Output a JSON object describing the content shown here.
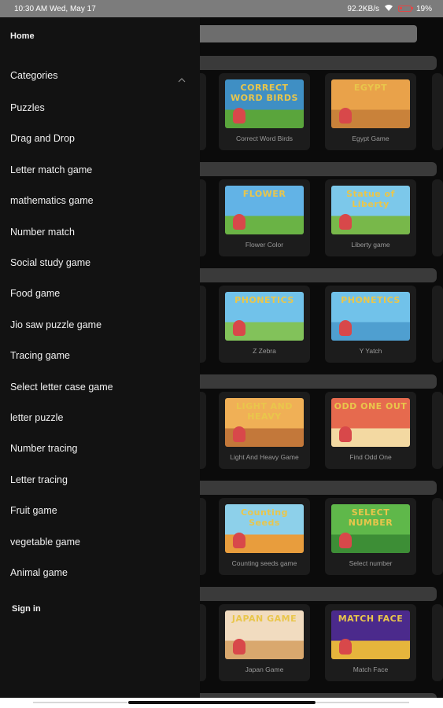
{
  "status_bar": {
    "time": "10:30 AM Wed, May 17",
    "network_speed": "92.2KB/s",
    "battery": "19%"
  },
  "drawer": {
    "home": "Home",
    "categories": "Categories",
    "items": [
      "Puzzles",
      "Drag and Drop",
      "Letter match game",
      "mathematics game",
      "Number match",
      "Social study game",
      "Food game",
      "Jio saw puzzle game",
      "Tracing game",
      "Select letter case game",
      "letter puzzle",
      "Number tracing",
      "Letter tracing",
      "Fruit game",
      "vegetable game",
      "Animal game"
    ],
    "sign_in": "Sign in"
  },
  "games": [
    [
      {
        "name": "Correct Word Birds",
        "thumb_title": "CORRECT WORD BIRDS",
        "bg": "#3f8fc4",
        "ground": "#5aa53c"
      },
      {
        "name": "Egypt Game",
        "thumb_title": "EGYPT",
        "bg": "#e9a24a",
        "ground": "#c9823a"
      }
    ],
    [
      {
        "name": "Flower Color",
        "thumb_title": "FLOWER",
        "bg": "#62b3e6",
        "ground": "#6ab345"
      },
      {
        "name": "Liberty game",
        "thumb_title": "Statue of Liberty",
        "bg": "#7cc8ea",
        "ground": "#78b84a"
      }
    ],
    [
      {
        "name": "Z Zebra",
        "thumb_title": "PHONETICS",
        "bg": "#71c2ea",
        "ground": "#82c25a"
      },
      {
        "name": "Y Yatch",
        "thumb_title": "PHONETICS",
        "bg": "#71c2ea",
        "ground": "#4f9fd0"
      }
    ],
    [
      {
        "name": "Light And Heavy Game",
        "thumb_title": "LIGHT AND HEAVY",
        "bg": "#f0b056",
        "ground": "#c3783a"
      },
      {
        "name": "Find Odd One",
        "thumb_title": "ODD ONE OUT",
        "bg": "#e66a4e",
        "ground": "#f3d9a2"
      }
    ],
    [
      {
        "name": "Counting seeds game",
        "thumb_title": "Counting Seeds",
        "bg": "#8dd0ea",
        "ground": "#e89d3d"
      },
      {
        "name": "Select number",
        "thumb_title": "SELECT NUMBER",
        "bg": "#5fb84a",
        "ground": "#3d8e36"
      }
    ],
    [
      {
        "name": "Japan Game",
        "thumb_title": "JAPAN GAME",
        "bg": "#f1dcc0",
        "ground": "#d9a86e"
      },
      {
        "name": "Match Face",
        "thumb_title": "MATCH FACE",
        "bg": "#4b2a8c",
        "ground": "#e6b53c"
      }
    ]
  ],
  "colors": {
    "drawer_bg": "#121212",
    "overlay_bg": "#0b0b0b",
    "battery_low": "#e04848"
  }
}
